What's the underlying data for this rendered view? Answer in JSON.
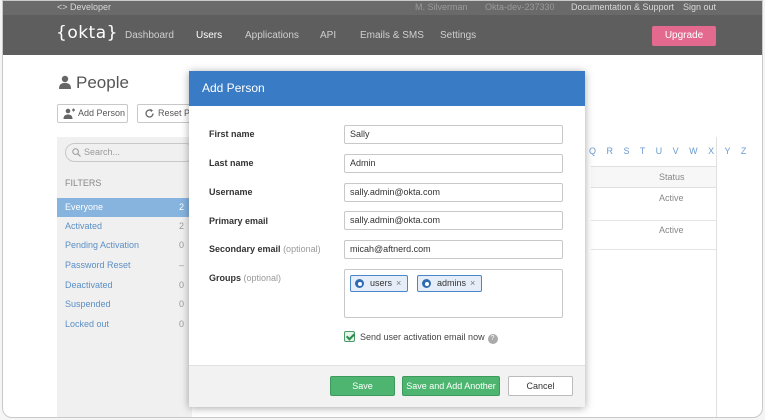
{
  "topbar": {
    "developer_label": "<> Developer",
    "user": "M. Silverman",
    "org": "Okta-dev-237330",
    "docs_label": "Documentation & Support",
    "signout_label": "Sign out"
  },
  "navbar": {
    "logo": "{okta}",
    "items": [
      "Dashboard",
      "Users",
      "Applications",
      "API",
      "Emails & SMS",
      "Settings"
    ],
    "active": "Users",
    "upgrade_label": "Upgrade",
    "upgrade_color": "#e36a8e"
  },
  "page": {
    "title": "People",
    "add_person_label": "Add Person",
    "reset_label": "Reset Pa",
    "search_placeholder": "Search...",
    "filters_label": "FILTERS",
    "filters": [
      {
        "label": "Everyone",
        "count": "2"
      },
      {
        "label": "Activated",
        "count": "2"
      },
      {
        "label": "Pending Activation",
        "count": "0"
      },
      {
        "label": "Password Reset",
        "count": "–"
      },
      {
        "label": "Deactivated",
        "count": "0"
      },
      {
        "label": "Suspended",
        "count": "0"
      },
      {
        "label": "Locked out",
        "count": "0"
      }
    ],
    "alphabet": "Q R S T U V W X Y Z",
    "status_header": "Status",
    "statuses": [
      "Active",
      "Active"
    ]
  },
  "modal": {
    "title": "Add Person",
    "header_color": "#3a7bc5",
    "fields": [
      {
        "label": "First name",
        "optional": "",
        "value": "Sally"
      },
      {
        "label": "Last name",
        "optional": "",
        "value": "Admin"
      },
      {
        "label": "Username",
        "optional": "",
        "value": "sally.admin@okta.com"
      },
      {
        "label": "Primary email",
        "optional": "",
        "value": "sally.admin@okta.com"
      },
      {
        "label": "Secondary email",
        "optional": "(optional)",
        "value": "micah@aftnerd.com"
      }
    ],
    "groups_label": "Groups",
    "groups_optional": "(optional)",
    "groups": [
      "users",
      "admins"
    ],
    "send_activation_label": "Send user activation email now",
    "send_activation_checked": true,
    "save_label": "Save",
    "save_add_label": "Save and Add Another",
    "cancel_label": "Cancel",
    "save_color": "#4db56f"
  }
}
